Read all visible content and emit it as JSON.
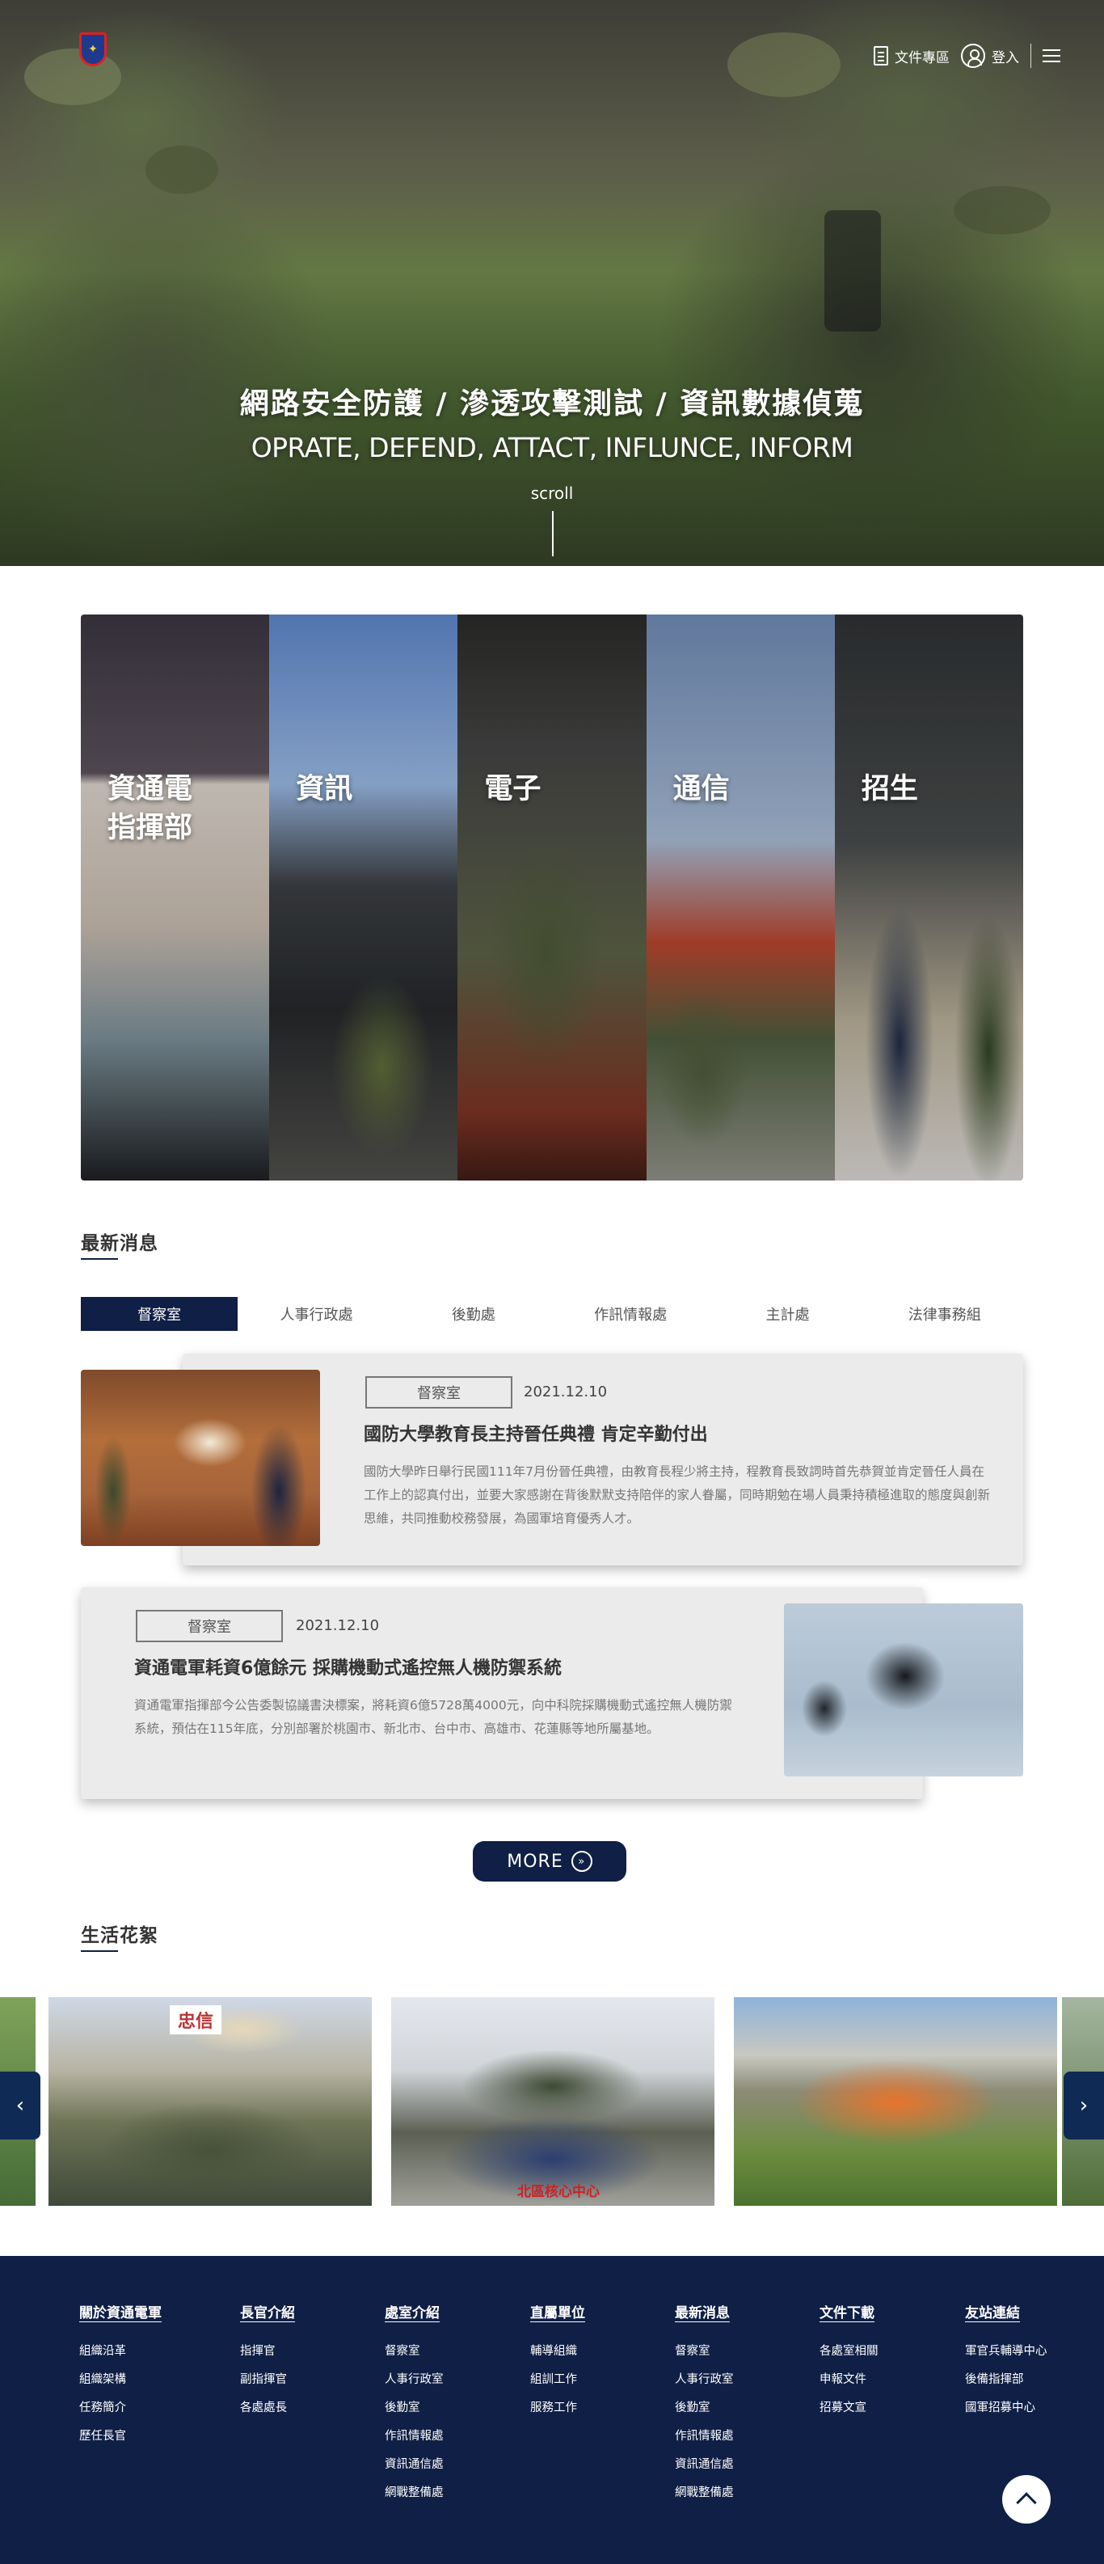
{
  "header": {
    "logo_symbol": "✦",
    "docs_label": "文件專區",
    "login_label": "登入"
  },
  "hero": {
    "title": "網路安全防護 / 滲透攻擊測試 / 資訊數據偵蒐",
    "subtitle": "OPRATE, DEFEND, ATTACT, INFLUNCE, INFORM",
    "scroll_label": "scroll"
  },
  "departments": [
    {
      "line1": "資通電",
      "line2": "指揮部"
    },
    {
      "line1": "資訊",
      "line2": ""
    },
    {
      "line1": "電子",
      "line2": ""
    },
    {
      "line1": "通信",
      "line2": ""
    },
    {
      "line1": "招生",
      "line2": ""
    }
  ],
  "news": {
    "section_title": "最新消息",
    "tabs": [
      "督察室",
      "人事行政處",
      "後勤處",
      "作訊情報處",
      "主計處",
      "法律事務組"
    ],
    "active_tab": 0,
    "items": [
      {
        "tag": "督察室",
        "date": "2021.12.10",
        "title": "國防大學教育長主持晉任典禮 肯定辛勤付出",
        "body": "國防大學昨日舉行民國111年7月份晉任典禮，由教育長程少將主持，程教育長致詞時首先恭賀並肯定晉任人員在工作上的認真付出，並要大家感謝在背後默默支持陪伴的家人眷屬，同時期勉在場人員秉持積極進取的態度與創新思維，共同推動校務發展，為國軍培育優秀人才。"
      },
      {
        "tag": "督察室",
        "date": "2021.12.10",
        "title": "資通電軍耗資6億餘元 採購機動式遙控無人機防禦系統",
        "body": "資通電軍指揮部今公告委製協議書決標案，將耗資6億5728萬4000元，向中科院採購機動式遙控無人機防禦系統，預估在115年底，分別部署於桃園市、新北市、台中市、高雄市、花蓮縣等地所屬基地。"
      }
    ],
    "more_label": "MORE"
  },
  "gallery": {
    "section_title": "生活花絮",
    "caption1": "忠信",
    "caption2": "北區核心中心"
  },
  "footer": {
    "columns": [
      {
        "head": "關於資通電軍",
        "links": [
          "組織沿革",
          "組織架構",
          "任務簡介",
          "歷任長官"
        ]
      },
      {
        "head": "長官介紹",
        "links": [
          "指揮官",
          "副指揮官",
          "各處處長"
        ]
      },
      {
        "head": "處室介紹",
        "links": [
          "督察室",
          "人事行政室",
          "後勤室",
          "作訊情報處",
          "資訊通信處",
          "網戰整備處"
        ]
      },
      {
        "head": "直屬單位",
        "links": [
          "輔導組織",
          "組訓工作",
          "服務工作"
        ]
      },
      {
        "head": "最新消息",
        "links": [
          "督察室",
          "人事行政室",
          "後勤室",
          "作訊情報處",
          "資訊通信處",
          "網戰整備處"
        ]
      },
      {
        "head": "文件下載",
        "links": [
          "各處室相關",
          "申報文件",
          "招募文宣"
        ]
      },
      {
        "head": "友站連結",
        "links": [
          "軍官兵輔導中心",
          "後備指揮部",
          "國軍招募中心"
        ]
      }
    ]
  },
  "colors": {
    "navy": "#0f1f45",
    "card_bg": "#ebebeb"
  }
}
